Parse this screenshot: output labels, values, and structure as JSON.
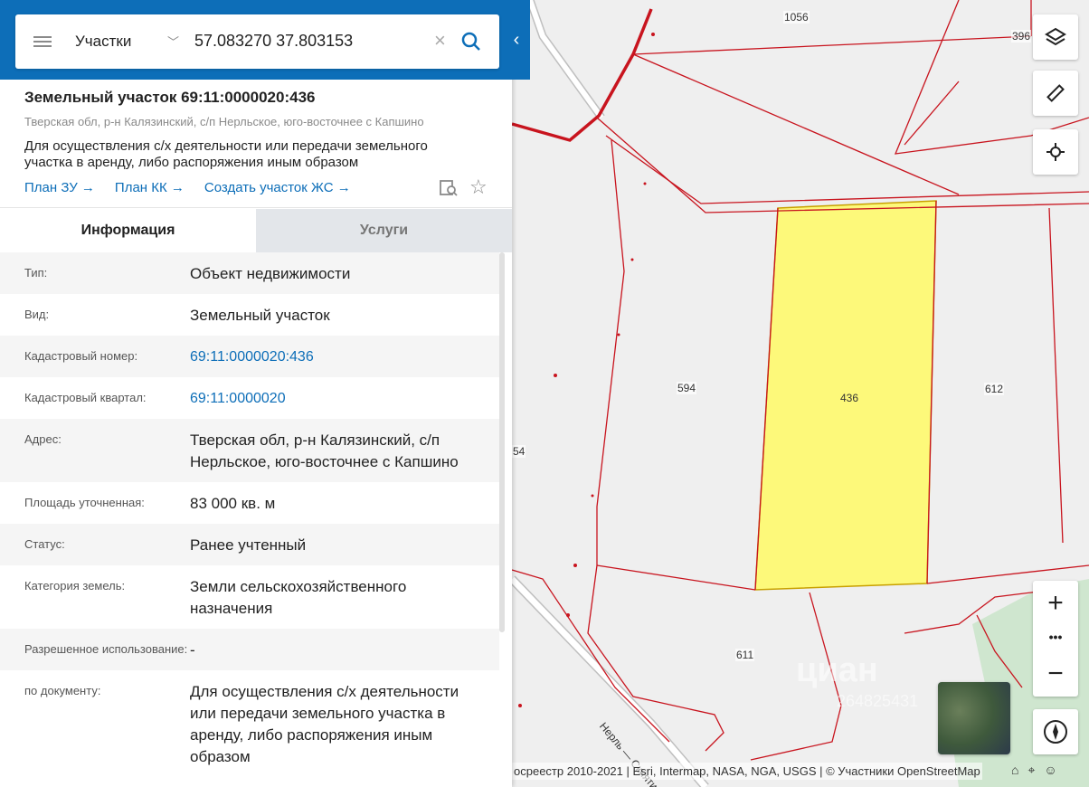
{
  "search": {
    "type_label": "Участки",
    "value": "57.083270 37.803153"
  },
  "parcel": {
    "title": "Земельный участок 69:11:0000020:436",
    "address": "Тверская обл, р-н Калязинский, с/п Нерльское, юго-восточнее с Капшино",
    "description": "Для осуществления с/х деятельности или передачи земельного участка в аренду, либо распоряжения иным образом",
    "links": [
      "План ЗУ →",
      "План КК →",
      "Создать участок ЖС →"
    ]
  },
  "tabs": [
    "Информация",
    "Услуги"
  ],
  "info_rows": [
    {
      "label": "Тип:",
      "value": "Объект недвижимости"
    },
    {
      "label": "Вид:",
      "value": "Земельный участок"
    },
    {
      "label": "Кадастровый номер:",
      "value": "69:11:0000020:436"
    },
    {
      "label": "Кадастровый квартал:",
      "value": "69:11:0000020"
    },
    {
      "label": "Адрес:",
      "value": "Тверская обл, р-н Калязинский, с/п Нерльское, юго-восточнее с Капшино"
    },
    {
      "label": "Площадь уточненная:",
      "value": "83 000 кв. м"
    },
    {
      "label": "Статус:",
      "value": "Ранее учтенный"
    },
    {
      "label": "Категория земель:",
      "value": "Земли сельскохозяйственного назначения"
    },
    {
      "label": "Разрешенное использование:",
      "value": "-"
    },
    {
      "label": "по документу:",
      "value": "Для осуществления с/х деятельности или передачи земельного участка в аренду, либо распоряжения иным образом"
    }
  ],
  "map": {
    "labels": [
      "1056",
      "396",
      "594",
      "436",
      "612",
      "611",
      "54"
    ],
    "road_label": "Нерль — Скнятино",
    "watermark": "циан",
    "watermark_id": "264825431",
    "attribution": "осреестр 2010-2021 | Esri, Intermap, NASA, NGA, USGS | © Участники OpenStreetMap",
    "highlight_color": "#fdf97a",
    "boundary_color": "#c8141e"
  },
  "controls": {
    "zoom_in": "+",
    "zoom_more": "•••",
    "zoom_out": "−"
  }
}
